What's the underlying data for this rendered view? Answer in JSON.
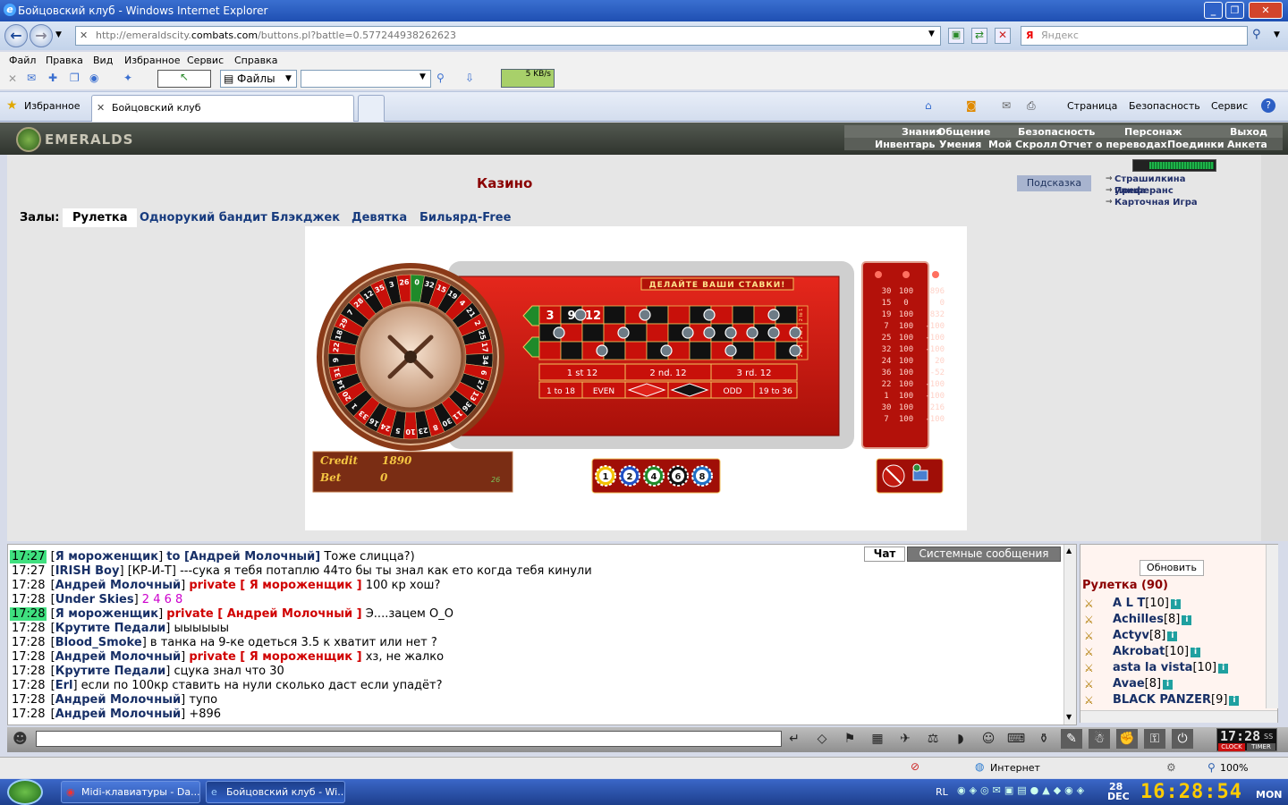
{
  "window": {
    "title": "Бойцовский клуб - Windows Internet Explorer"
  },
  "address": {
    "url_prefix": "http://emeraldscity.",
    "url_domain": "combats.com",
    "url_suffix": "/buttons.pl?battle=0.577244938262623",
    "search_placeholder": "Яндекс"
  },
  "menu": [
    "Файл",
    "Правка",
    "Вид",
    "Избранное",
    "Сервис",
    "Справка"
  ],
  "toolbar": {
    "files_label": "Файлы",
    "speed": "5 KB/s"
  },
  "favorites": {
    "label": "Избранное",
    "tab_title": "Бойцовский клуб"
  },
  "ie_commands": {
    "page": "Страница",
    "security": "Безопасность",
    "service": "Сервис"
  },
  "site": {
    "logo": "EMERALDS",
    "nav_top": [
      "Знания",
      "Общение",
      "Безопасность",
      "Персонаж",
      "Выход"
    ],
    "nav_bottom": [
      "Инвентарь",
      "Умения",
      "Мой Скролл",
      "Отчет о переводах",
      "Поединки",
      "Анкета"
    ]
  },
  "casino": {
    "title": "Казино",
    "hint_button": "Подсказка",
    "side_links": [
      "Страшилкина улица",
      "Преферанс",
      "Карточная Игра"
    ],
    "halls_label": "Залы:",
    "halls": [
      "Рулетка",
      "Однорукий бандит",
      "Блэкджек",
      "Девятка",
      "Бильярд-Free"
    ]
  },
  "roulette": {
    "banner": "ДЕЛАЙТЕ ВАШИ СТАВКИ!",
    "wheel_numbers": [
      "0",
      "32",
      "15",
      "19",
      "4",
      "21",
      "2",
      "25",
      "17",
      "34",
      "6",
      "27",
      "13",
      "36",
      "11",
      "30",
      "8",
      "23",
      "10",
      "5",
      "24",
      "16",
      "33",
      "1",
      "20",
      "14",
      "31",
      "9",
      "22",
      "18",
      "29",
      "7",
      "28",
      "12",
      "35",
      "3",
      "26"
    ],
    "table_numbers": [
      "3",
      "9",
      "12"
    ],
    "dozens": [
      "1 st 12",
      "2 nd. 12",
      "3 rd. 12"
    ],
    "outside": [
      "1 to 18",
      "EVEN",
      "ODD",
      "19 to 36"
    ],
    "column_label": "2 to 1",
    "credit_label": "Credit",
    "credit_value": "1890",
    "bet_label": "Bet",
    "bet_value": "0",
    "corner_num": "26",
    "chips": [
      "1",
      "2",
      "4",
      "6",
      "8"
    ],
    "history": [
      [
        "30",
        "100",
        "896"
      ],
      [
        "15",
        "0",
        "0"
      ],
      [
        "19",
        "100",
        "832"
      ],
      [
        "7",
        "100",
        "-100"
      ],
      [
        "25",
        "100",
        "-100"
      ],
      [
        "32",
        "100",
        "-100"
      ],
      [
        "24",
        "100",
        "20"
      ],
      [
        "36",
        "100",
        "-52"
      ],
      [
        "22",
        "100",
        "-100"
      ],
      [
        "1",
        "100",
        "-100"
      ],
      [
        "30",
        "100",
        "216"
      ],
      [
        "7",
        "100",
        "-100"
      ]
    ]
  },
  "chat": {
    "tabs": [
      "Чат",
      "Системные сообщения"
    ],
    "lines": [
      {
        "time": "17:27",
        "hl": true,
        "nick": "Я мороженщик",
        "to": "to [Андрей Молочный]",
        "priv": "",
        "text": " Тоже слицца?)",
        "pink": false
      },
      {
        "time": "17:27",
        "hl": false,
        "nick": "IRISH Boy",
        "to": "",
        "priv": "",
        "text": " [КР-И-Т] ---сука я тебя потаплю 44то бы ты знал как ето когда тебя кинули",
        "pink": false
      },
      {
        "time": "17:28",
        "hl": false,
        "nick": "Андрей Молочный",
        "to": "",
        "priv": "private [ Я мороженщик ]",
        "text": " 100 кр хош?",
        "pink": false
      },
      {
        "time": "17:28",
        "hl": false,
        "nick": "Under Skies",
        "to": "",
        "priv": "",
        "text": " 2 4 6 8",
        "pink": true
      },
      {
        "time": "17:28",
        "hl": true,
        "nick": "Я мороженщик",
        "to": "",
        "priv": "private [ Андрей Молочный ]",
        "text": " Э....зацем О_О",
        "pink": false
      },
      {
        "time": "17:28",
        "hl": false,
        "nick": "Крутите Педали",
        "to": "",
        "priv": "",
        "text": " ыыыыыы",
        "pink": false
      },
      {
        "time": "17:28",
        "hl": false,
        "nick": "Blood_Smoke",
        "to": "",
        "priv": "",
        "text": " в танка на 9-ке одеться 3.5 к хватит или нет ?",
        "pink": false
      },
      {
        "time": "17:28",
        "hl": false,
        "nick": "Андрей Молочный",
        "to": "",
        "priv": "private [ Я мороженщик ]",
        "text": " хз, не жалко",
        "pink": false
      },
      {
        "time": "17:28",
        "hl": false,
        "nick": "Крутите Педали",
        "to": "",
        "priv": "",
        "text": " сцука знал что 30",
        "pink": false
      },
      {
        "time": "17:28",
        "hl": false,
        "nick": "Erl",
        "to": "",
        "priv": "",
        "text": " если по 100кр ставить на нули сколько даст если упадёт?",
        "pink": false
      },
      {
        "time": "17:28",
        "hl": false,
        "nick": "Андрей Молочный",
        "to": "",
        "priv": "",
        "text": " тупо",
        "pink": false
      },
      {
        "time": "17:28",
        "hl": false,
        "nick": "Андрей Молочный",
        "to": "",
        "priv": "",
        "text": " +896",
        "pink": false
      }
    ]
  },
  "userlist": {
    "refresh": "Обновить",
    "room": "Рулетка (90)",
    "users": [
      {
        "name": "A L T",
        "level": "[10]"
      },
      {
        "name": "Achilles",
        "level": "[8]"
      },
      {
        "name": "Actyv",
        "level": "[8]"
      },
      {
        "name": "Akrobat",
        "level": "[10]"
      },
      {
        "name": "asta la vista",
        "level": "[10]"
      },
      {
        "name": "Avae",
        "level": "[8]"
      },
      {
        "name": "BLACK PANZER",
        "level": "[9]"
      }
    ]
  },
  "game_clock": {
    "time": "17:28",
    "sec": "SS",
    "clock_label": "CLOCK",
    "timer_label": "TIMER"
  },
  "statusbar": {
    "zone": "Интернет",
    "zoom": "100%"
  },
  "taskbar": {
    "tasks": [
      "Midi-клавиатуры - Da...",
      "Бойцовский клуб - Wi..."
    ],
    "lang": "RL",
    "date_day": "28",
    "date_month": "DEC",
    "time": "16:28:54",
    "weekday": "MON"
  }
}
